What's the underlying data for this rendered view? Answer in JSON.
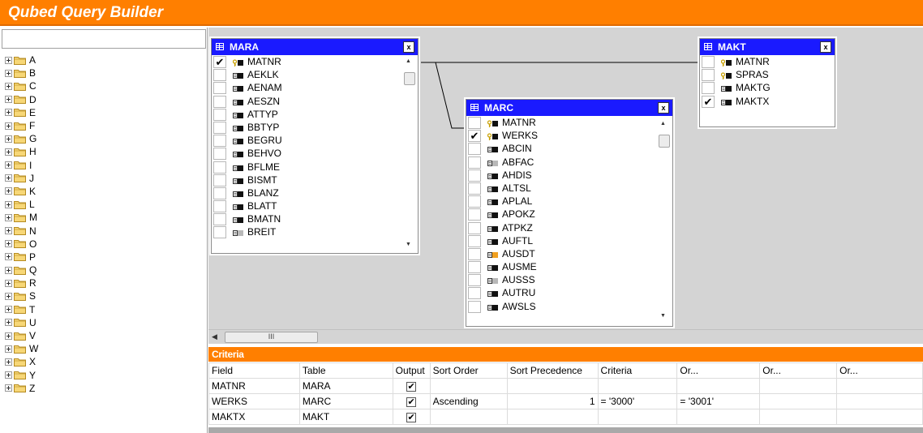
{
  "app": {
    "title": "Qubed Query Builder"
  },
  "sidebar": {
    "search_value": "",
    "items": [
      "A",
      "B",
      "C",
      "D",
      "E",
      "F",
      "G",
      "H",
      "I",
      "J",
      "K",
      "L",
      "M",
      "N",
      "O",
      "P",
      "Q",
      "R",
      "S",
      "T",
      "U",
      "V",
      "W",
      "X",
      "Y",
      "Z"
    ]
  },
  "tables": {
    "mara": {
      "name": "MARA",
      "fields": [
        {
          "name": "MATNR",
          "checked": true,
          "icon": "key-icon"
        },
        {
          "name": "AEKLK",
          "checked": false,
          "icon": "field-icon"
        },
        {
          "name": "AENAM",
          "checked": false,
          "icon": "field-icon"
        },
        {
          "name": "AESZN",
          "checked": false,
          "icon": "field-icon"
        },
        {
          "name": "ATTYP",
          "checked": false,
          "icon": "field-icon"
        },
        {
          "name": "BBTYP",
          "checked": false,
          "icon": "field-icon"
        },
        {
          "name": "BEGRU",
          "checked": false,
          "icon": "field-icon"
        },
        {
          "name": "BEHVO",
          "checked": false,
          "icon": "field-icon"
        },
        {
          "name": "BFLME",
          "checked": false,
          "icon": "field-icon"
        },
        {
          "name": "BISMT",
          "checked": false,
          "icon": "field-icon"
        },
        {
          "name": "BLANZ",
          "checked": false,
          "icon": "field-icon"
        },
        {
          "name": "BLATT",
          "checked": false,
          "icon": "field-icon"
        },
        {
          "name": "BMATN",
          "checked": false,
          "icon": "field-icon"
        },
        {
          "name": "BREIT",
          "checked": false,
          "icon": "field-icon-gray"
        }
      ]
    },
    "marc": {
      "name": "MARC",
      "fields": [
        {
          "name": "MATNR",
          "checked": false,
          "icon": "key-icon"
        },
        {
          "name": "WERKS",
          "checked": true,
          "icon": "key-icon"
        },
        {
          "name": "ABCIN",
          "checked": false,
          "icon": "field-icon"
        },
        {
          "name": "ABFAC",
          "checked": false,
          "icon": "field-icon-gray"
        },
        {
          "name": "AHDIS",
          "checked": false,
          "icon": "field-icon"
        },
        {
          "name": "ALTSL",
          "checked": false,
          "icon": "field-icon"
        },
        {
          "name": "APLAL",
          "checked": false,
          "icon": "field-icon"
        },
        {
          "name": "APOKZ",
          "checked": false,
          "icon": "field-icon"
        },
        {
          "name": "ATPKZ",
          "checked": false,
          "icon": "field-icon"
        },
        {
          "name": "AUFTL",
          "checked": false,
          "icon": "field-icon"
        },
        {
          "name": "AUSDT",
          "checked": false,
          "icon": "field-icon-orange"
        },
        {
          "name": "AUSME",
          "checked": false,
          "icon": "field-icon"
        },
        {
          "name": "AUSSS",
          "checked": false,
          "icon": "field-icon-gray"
        },
        {
          "name": "AUTRU",
          "checked": false,
          "icon": "field-icon"
        },
        {
          "name": "AWSLS",
          "checked": false,
          "icon": "field-icon"
        }
      ]
    },
    "makt": {
      "name": "MAKT",
      "fields": [
        {
          "name": "MATNR",
          "checked": false,
          "icon": "key-icon"
        },
        {
          "name": "SPRAS",
          "checked": false,
          "icon": "key-icon"
        },
        {
          "name": "MAKTG",
          "checked": false,
          "icon": "field-icon"
        },
        {
          "name": "MAKTX",
          "checked": true,
          "icon": "field-icon"
        }
      ]
    }
  },
  "hscroll": {
    "thumb_label": "III"
  },
  "criteria": {
    "title": "Criteria",
    "columns": [
      "Field",
      "Table",
      "Output",
      "Sort Order",
      "Sort Precedence",
      "Criteria",
      "Or...",
      "Or...",
      "Or..."
    ],
    "rows": [
      {
        "field": "MATNR",
        "table": "MARA",
        "output": true,
        "sort_order": "",
        "sort_precedence": "",
        "criteria": "",
        "or1": "",
        "or2": "",
        "or3": ""
      },
      {
        "field": "WERKS",
        "table": "MARC",
        "output": true,
        "sort_order": "Ascending",
        "sort_precedence": "1",
        "criteria": "= '3000'",
        "or1": "= '3001'",
        "or2": "",
        "or3": ""
      },
      {
        "field": "MAKTX",
        "table": "MAKT",
        "output": true,
        "sort_order": "",
        "sort_precedence": "",
        "criteria": "",
        "or1": "",
        "or2": "",
        "or3": ""
      }
    ]
  },
  "colors": {
    "accent": "#ff7f00",
    "table_header": "#1a1aff",
    "canvas": "#d4d4d4"
  }
}
